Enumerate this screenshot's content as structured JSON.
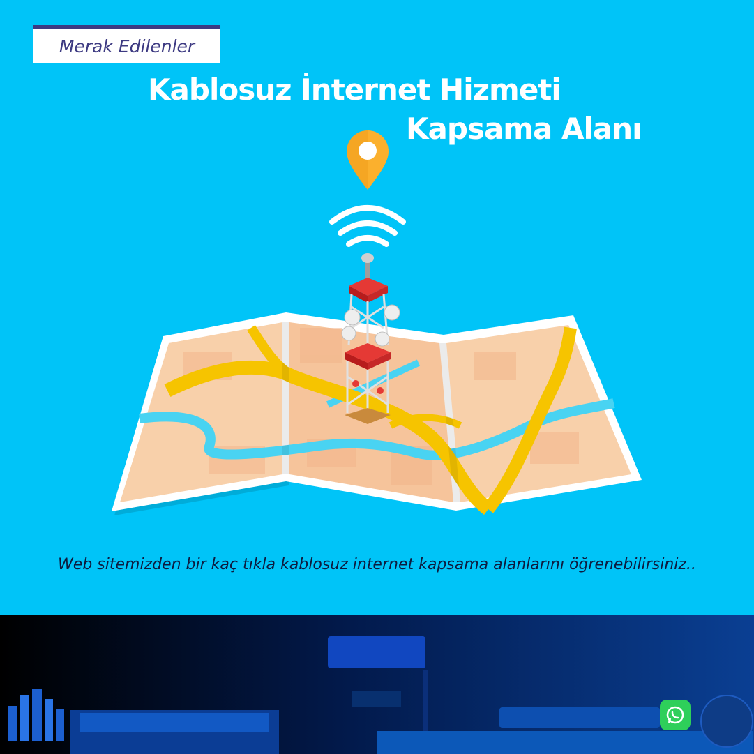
{
  "header": {
    "tab_label": "Merak Edilenler",
    "title_line1": "Kablosuz İnternet Hizmeti",
    "title_line2": "Kapsama Alanı"
  },
  "caption": "Web sitemizden bir kaç tıkla kablosuz internet kapsama alanlarını öğrenebilirsiniz..",
  "icons": {
    "location": "location-pin-icon",
    "wifi": "wifi-signal-icon",
    "tower": "cell-tower-icon",
    "map": "folded-map-icon",
    "whatsapp": "whatsapp-icon",
    "logo": "company-logo-icon"
  },
  "colors": {
    "background": "#00c4f8",
    "tab_border": "#3d3a82",
    "title": "#ffffff",
    "caption": "#0d1b3f",
    "pin": "#f5a623",
    "road": "#f6c400",
    "river": "#49d3f2",
    "map_land": "#f6c7a1",
    "tower_red": "#e53935"
  }
}
